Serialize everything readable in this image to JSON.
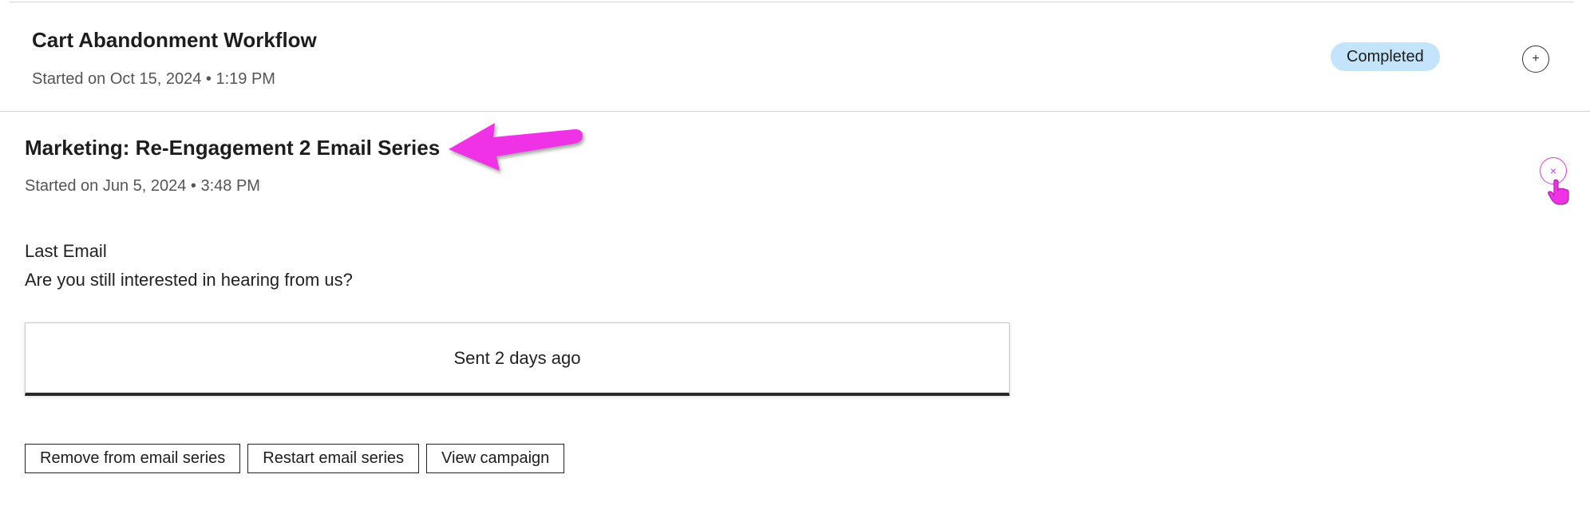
{
  "workflows": [
    {
      "title": "Cart Abandonment Workflow",
      "started": "Started on Oct 15, 2024 • 1:19 PM",
      "status": "Completed",
      "expand_glyph": "+"
    }
  ],
  "series": {
    "title": "Marketing: Re-Engagement 2 Email Series",
    "started": "Started on Jun 5, 2024 • 3:48 PM",
    "collapse_glyph": "×",
    "last_email_label": "Last Email",
    "last_email_subject": "Are you still interested in hearing from us?",
    "sent_status": "Sent 2 days ago",
    "actions": {
      "remove": "Remove from email series",
      "restart": "Restart email series",
      "view": "View campaign"
    }
  },
  "colors": {
    "status_badge_bg": "#c3e4fa",
    "annotation": "#f032e6",
    "text_primary": "#1d1d1d",
    "text_secondary": "#555555"
  },
  "icons": {
    "expand": "plus-icon",
    "collapse": "close-icon",
    "pointer": "hand-pointer-icon",
    "annotation": "arrow-annotation-icon"
  }
}
